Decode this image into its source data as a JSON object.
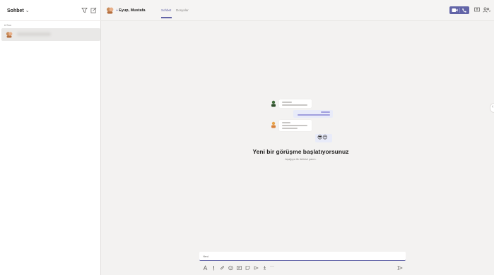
{
  "sidebar": {
    "title": "Sohbet",
    "title_chevron": "⌄",
    "recent_label": "▾ Son",
    "chat_item_name_hidden": true
  },
  "header": {
    "participants": "Eyup, Mustafa",
    "participant_prefix": "+",
    "tabs": [
      {
        "label": "Sohbet",
        "active": true
      },
      {
        "label": "Dosyalar",
        "active": false
      }
    ],
    "icons": [
      "video-call-icon",
      "audio-call-icon",
      "screen-share-icon",
      "people-icon"
    ]
  },
  "empty_state": {
    "title": "Yeni bir görüşme başlatıyorsunuz",
    "subtitle": "Aşağıya ilk iletinizi yazın.",
    "emoji": "😎😊"
  },
  "composer": {
    "placeholder": "Yeni",
    "toolbar_icons": [
      "format-icon",
      "priority-icon",
      "attach-icon",
      "emoji-icon",
      "gif-icon",
      "sticker-icon",
      "meet-icon",
      "praise-icon",
      "more-icon"
    ],
    "more_label": "···"
  },
  "colors": {
    "accent": "#6264a7",
    "background": "#f3f2f1",
    "sidebar": "#ffffff"
  }
}
